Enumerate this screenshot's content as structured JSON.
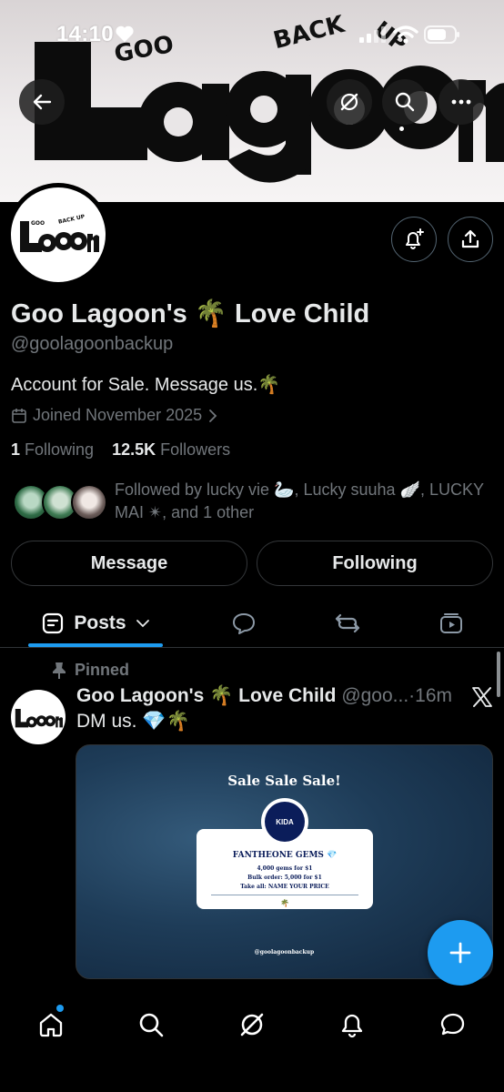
{
  "status_bar": {
    "time": "14:10"
  },
  "banner": {
    "logo_top": "GOO",
    "logo_arc": "BACK UP",
    "logo_main": "Lagoon"
  },
  "profile": {
    "display_name": "Goo Lagoon's 🌴 Love Child",
    "handle": "@goolagoonbackup",
    "bio": "Account for Sale. Message us.🌴",
    "joined": "Joined November 2025",
    "following_count": "1",
    "following_label": "Following",
    "followers_count": "12.5K",
    "followers_label": "Followers",
    "followed_by": "Followed by lucky vie 🦢, Lucky suuha 🪽, LUCKY MAI ✴, and 1 other",
    "message_button": "Message",
    "following_button": "Following"
  },
  "tabs": {
    "posts_label": "Posts"
  },
  "post": {
    "pinned_label": "Pinned",
    "author_name": "Goo Lagoon's 🌴 Love Child",
    "author_handle": "@goo...",
    "separator": "·",
    "time": "16m",
    "text": "DM us. 💎🌴",
    "media": {
      "title": "Sale Sale Sale!",
      "badge_text": "KIDA",
      "card_title": "FANTHEONE GEMS 💎",
      "card_line1": "4,000 gems for $1",
      "card_line2": "Bulk order: 5,000 for $1",
      "card_line3": "Take all: NAME YOUR PRICE",
      "card_emoji": "🌴",
      "footer_handle": "@goolagoonbackup"
    }
  },
  "icons": [
    "back-arrow-icon",
    "grok-icon",
    "search-icon",
    "more-icon",
    "notify-icon",
    "share-icon",
    "calendar-icon",
    "chevron-right-icon",
    "post-list-icon",
    "chevron-down-icon",
    "reply-icon",
    "repost-icon",
    "media-icon",
    "pin-icon",
    "x-logo-icon",
    "plus-icon",
    "home-icon",
    "bell-icon",
    "messages-icon"
  ],
  "colors": {
    "accent": "#1d9bf0",
    "muted": "#71767b",
    "text": "#e7e9ea",
    "background": "#000000"
  }
}
